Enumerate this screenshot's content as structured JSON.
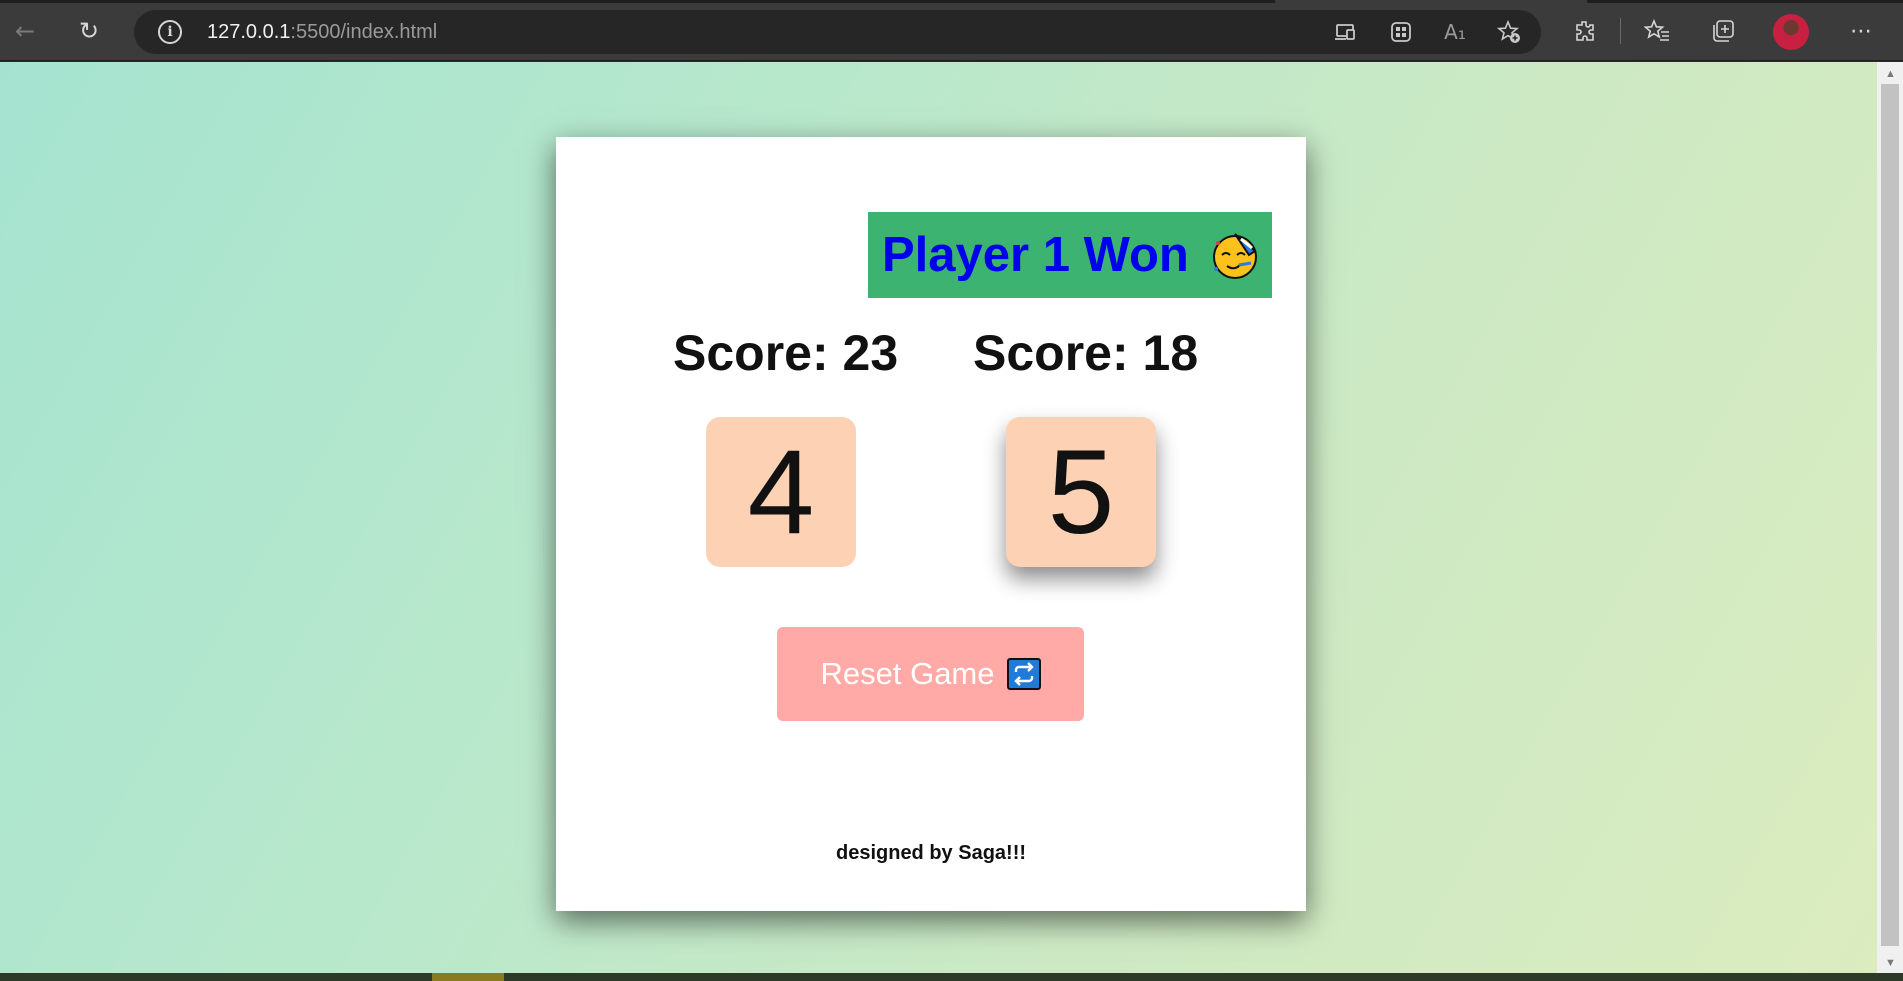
{
  "browser": {
    "url_host": "127.0.0.1",
    "url_rest": ":5500/index.html",
    "icons": [
      "back-icon",
      "reload-icon",
      "info-icon",
      "app-available-icon",
      "apps-icon",
      "read-aloud-icon",
      "add-favorite-icon",
      "extensions-icon",
      "favorites-icon",
      "collections-icon",
      "profile-avatar",
      "more-icon"
    ]
  },
  "game": {
    "winner_text": "Player 1 Won",
    "winner_emoji": "partying-face-icon",
    "players": [
      {
        "score_label": "Score: 23",
        "die_value": "4"
      },
      {
        "score_label": "Score: 18",
        "die_value": "5"
      }
    ],
    "reset_label": "Reset Game",
    "reset_icon": "repeat-icon",
    "credit": "designed by Saga!!!"
  },
  "colors": {
    "banner_bg": "#3cb371",
    "banner_text": "#0000ee",
    "die_bg": "#fdd1b4",
    "reset_bg": "#ffaaa6"
  }
}
